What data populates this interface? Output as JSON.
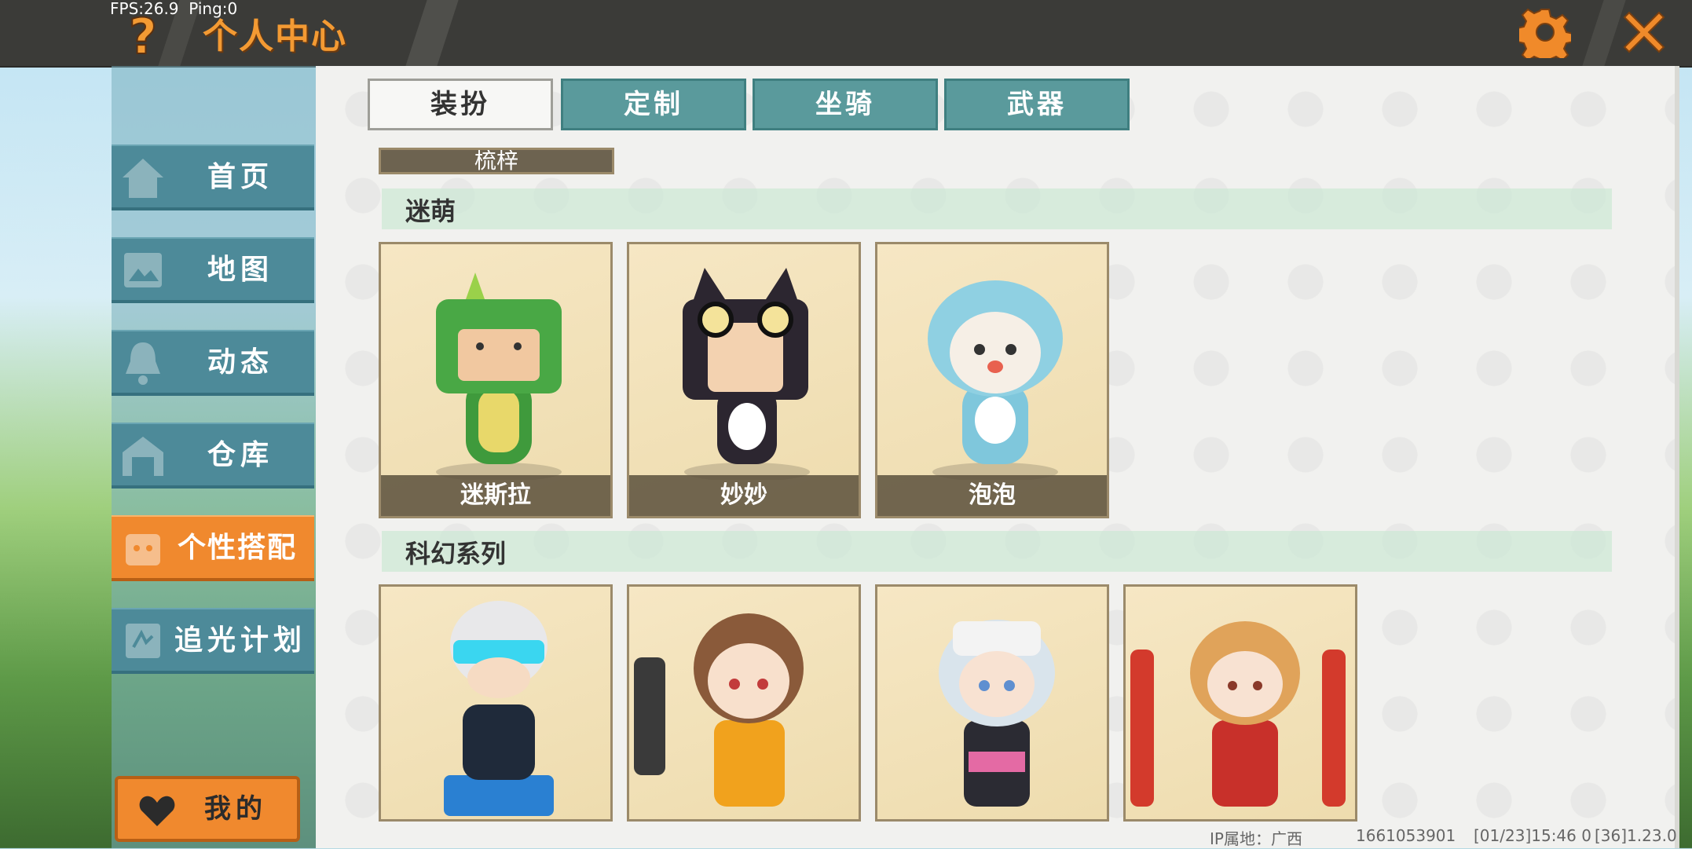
{
  "status": {
    "fps": "FPS:26.9",
    "ping": "Ping:0"
  },
  "header": {
    "title": "个人中心",
    "help_icon": "question-mark-icon",
    "settings_icon": "gear-icon",
    "close_icon": "close-x-icon"
  },
  "sidebar": {
    "items": [
      {
        "label": "首页",
        "icon": "home-icon",
        "active": false
      },
      {
        "label": "地图",
        "icon": "map-icon",
        "active": false
      },
      {
        "label": "动态",
        "icon": "bell-icon",
        "active": false
      },
      {
        "label": "仓库",
        "icon": "warehouse-icon",
        "active": false
      },
      {
        "label": "个性搭配",
        "icon": "outfit-icon",
        "active": true
      },
      {
        "label": "追光计划",
        "icon": "light-plan-icon",
        "active": false
      }
    ],
    "mine_button": {
      "label": "我的",
      "icon": "heart-icon"
    }
  },
  "tabs": [
    {
      "label": "装扮",
      "active": true
    },
    {
      "label": "定制",
      "active": false
    },
    {
      "label": "坐骑",
      "active": false
    },
    {
      "label": "武器",
      "active": false
    }
  ],
  "sections": [
    {
      "title": "迷萌",
      "partial_card_label": "梳梓",
      "items": [
        {
          "name": "迷斯拉",
          "theme": "green-dinosaur"
        },
        {
          "name": "妙妙",
          "theme": "black-cat"
        },
        {
          "name": "泡泡",
          "theme": "blue-dolphin"
        }
      ]
    },
    {
      "title": "科幻系列",
      "items": [
        {
          "name": "",
          "theme": "cyber-white-hair"
        },
        {
          "name": "",
          "theme": "brown-hair-girl"
        },
        {
          "name": "",
          "theme": "silver-hair-girl"
        },
        {
          "name": "",
          "theme": "red-mecha-girl"
        }
      ]
    }
  ],
  "footer": {
    "ip_location": "IP属地：广西",
    "uid": "1661053901",
    "timestamp": "[01/23]15:46 0",
    "version": "[36]1.23.0"
  },
  "colors": {
    "accent_orange": "#f0892e",
    "teal": "#5a9a9c",
    "topbar": "#3b3b38"
  }
}
